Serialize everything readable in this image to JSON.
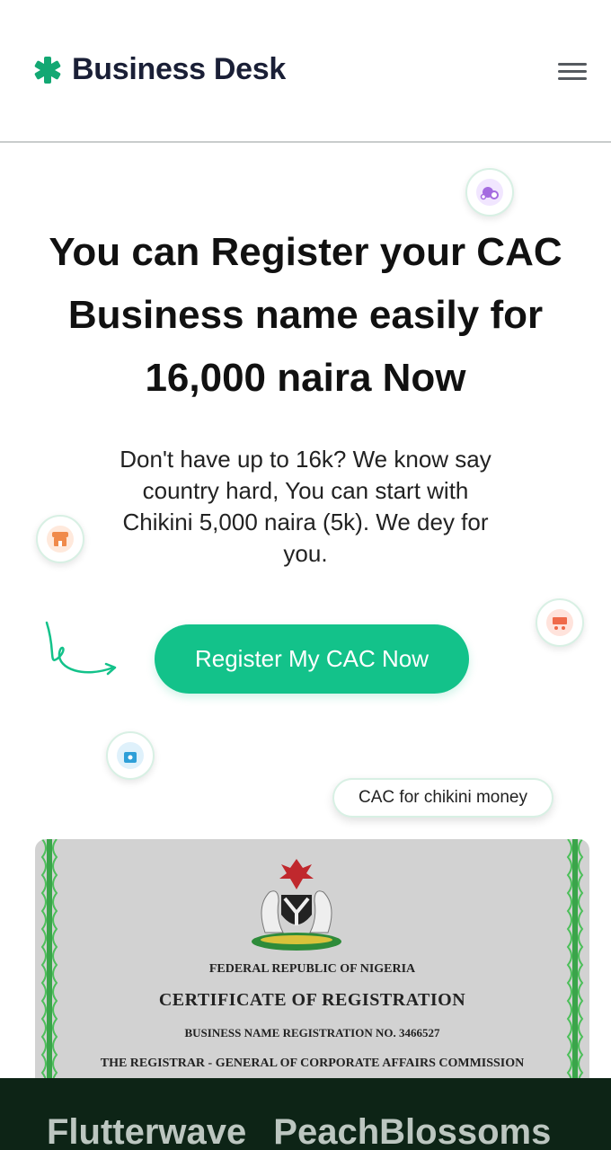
{
  "header": {
    "brand": "Business Desk",
    "brand_icon": "green-asterisk-icon",
    "menu_icon": "hamburger-menu-icon"
  },
  "hero": {
    "title_line1": "You can Register your CAC",
    "title_line2": "Business name easily for",
    "title_line3": "16,000 naira Now",
    "subtitle_line1": "Don't have up to 16k? We know say",
    "subtitle_line2": "country hard, You can start with",
    "subtitle_line3": "Chikini 5,000 naira (5k). We dey for",
    "subtitle_line4": "you.",
    "cta_label": "Register My CAC Now",
    "badge": "CAC for chikini money"
  },
  "floating_icons": [
    "money-bag-icon",
    "storefront-icon",
    "shopping-cart-icon",
    "shopping-bag-icon"
  ],
  "certificate": {
    "line1": "FEDERAL REPUBLIC OF NIGERIA",
    "line2": "CERTIFICATE OF REGISTRATION",
    "line3": "BUSINESS NAME REGISTRATION NO. 3466527",
    "line4": "THE REGISTRAR - GENERAL OF CORPORATE AFFAIRS COMMISSION"
  },
  "partners": [
    "Flutterwave",
    "PeachBlossoms"
  ],
  "colors": {
    "accent": "#13c28a",
    "brand_text": "#1a1f36",
    "footer_bg": "#0d2416",
    "certificate_bg": "#d2d2d2"
  }
}
